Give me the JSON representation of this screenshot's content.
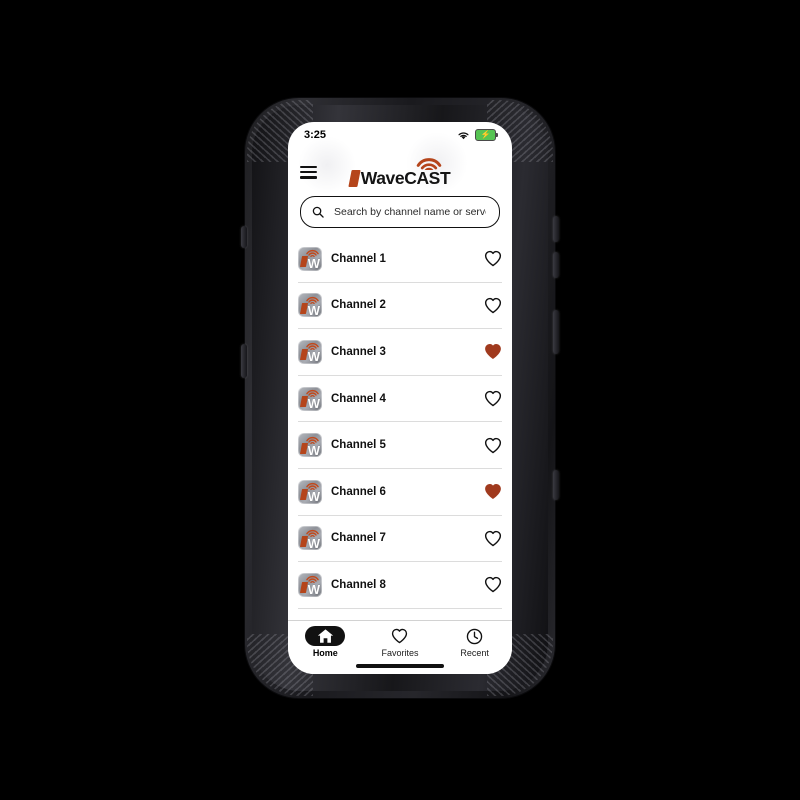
{
  "theme": {
    "brand_color": "#b5451b",
    "heart_filled_color": "#a03a1e",
    "text_color": "#111111",
    "battery_color": "#56c453",
    "screen_background": "#ffffff",
    "case_color": "#1d1d20"
  },
  "status_bar": {
    "time": "3:25",
    "wifi_icon": "wifi-icon",
    "battery_icon": "battery-charging-icon",
    "battery_bolt": "⚡"
  },
  "header": {
    "menu_icon": "hamburger-menu-icon",
    "logo_text": "WaveCAST",
    "logo_mark_icon": "wavecast-parallelogram-icon",
    "logo_wifi_icon": "wifi-arcs-icon"
  },
  "search": {
    "icon": "search-icon",
    "placeholder": "Search by channel name or server IP",
    "value": ""
  },
  "channels": [
    {
      "name": "Channel 1",
      "favorite": false,
      "icon": "wavecast-channel-icon"
    },
    {
      "name": "Channel 2",
      "favorite": false,
      "icon": "wavecast-channel-icon"
    },
    {
      "name": "Channel 3",
      "favorite": true,
      "icon": "wavecast-channel-icon"
    },
    {
      "name": "Channel 4",
      "favorite": false,
      "icon": "wavecast-channel-icon"
    },
    {
      "name": "Channel 5",
      "favorite": false,
      "icon": "wavecast-channel-icon"
    },
    {
      "name": "Channel 6",
      "favorite": true,
      "icon": "wavecast-channel-icon"
    },
    {
      "name": "Channel 7",
      "favorite": false,
      "icon": "wavecast-channel-icon"
    },
    {
      "name": "Channel 8",
      "favorite": false,
      "icon": "wavecast-channel-icon"
    }
  ],
  "bottom_nav": {
    "items": [
      {
        "label": "Home",
        "icon": "home-icon",
        "active": true
      },
      {
        "label": "Favorites",
        "icon": "heart-icon",
        "active": false
      },
      {
        "label": "Recent",
        "icon": "clock-icon",
        "active": false
      }
    ]
  }
}
